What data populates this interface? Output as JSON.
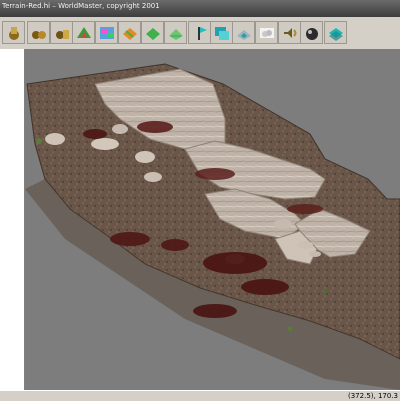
{
  "window": {
    "title": "Terrain-Red.hi – WorldMaster, copyright 2001"
  },
  "toolbar": {
    "buttons": [
      {
        "name": "hand-tool-icon"
      },
      {
        "name": "group-tool-icon"
      },
      {
        "name": "morph-tool-icon"
      },
      {
        "name": "terrain-map-icon"
      },
      {
        "name": "layer-grid-icon"
      },
      {
        "name": "mesh-grid-icon"
      },
      {
        "name": "surface-grid-icon"
      },
      {
        "name": "raise-tool-icon"
      },
      {
        "name": "flag-marker-icon"
      },
      {
        "name": "water-tool-icon"
      },
      {
        "name": "erosion-tool-icon"
      },
      {
        "name": "sky-clouds-icon"
      },
      {
        "name": "sound-icon"
      },
      {
        "name": "light-sphere-icon"
      },
      {
        "name": "render-view-icon"
      }
    ]
  },
  "status": {
    "coordinates": "(372.5), 170.3"
  }
}
